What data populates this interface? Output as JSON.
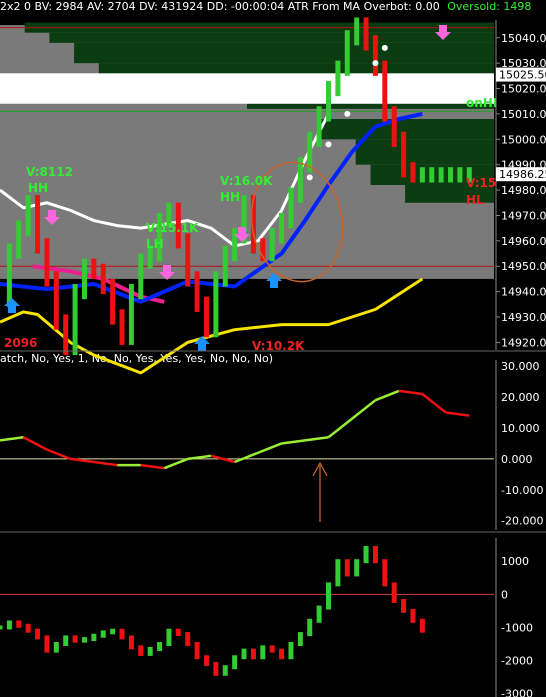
{
  "header": {
    "status_text": "2x2 0 BV: 2984 AV: 2704 DV: 431924 DD: -00:00:04 ATR From MA  Overbot: 0.00",
    "oversold_text": "Oversold: 1498"
  },
  "indicator_params": "atch, No, Yes, 1, No, No, Yes, Yes, Yes, No, No, No)",
  "colors": {
    "background": "#000000",
    "volume_profile": "#0c3d12",
    "value_area": "#7a7a7a",
    "up_bar": "#33cc33",
    "down_bar": "#ee1111",
    "blue_ma": "#0022ff",
    "white_ma": "#ffffff",
    "yellow_ma": "#f5e400",
    "magenta_ma": "#ee1e8c",
    "annotation_green": "#33ee33",
    "annotation_red": "#ee2222",
    "arrow_pink": "#ff66dd",
    "arrow_blue": "#1e90ff",
    "hand_drawn": "#c8642a"
  },
  "chart_data": [
    {
      "type": "candlestick",
      "title": "",
      "y_axis_labels": [
        "15040.00",
        "15030.00",
        "15020.00",
        "15010.00",
        "15000.00",
        "14990.00",
        "14980.00",
        "14970.00",
        "14960.00",
        "14950.00",
        "14940.00",
        "14930.00",
        "14920.00"
      ],
      "ylim": [
        14917,
        15047
      ],
      "price_tag": "15025.50",
      "last_price_tag": "14986.25",
      "series": [
        {
          "name": "price",
          "x": [
            0,
            2,
            4,
            6,
            8,
            10,
            12,
            14,
            16,
            18,
            20,
            22,
            24,
            26,
            28,
            30,
            32,
            34,
            36,
            38,
            40,
            42,
            44,
            46,
            48,
            50,
            52,
            54,
            56,
            58,
            60,
            62,
            64,
            66,
            68,
            70,
            72,
            74,
            76,
            78,
            80,
            82,
            84,
            86,
            88,
            90,
            92,
            94,
            96,
            98,
            100
          ],
          "values": [
            14937,
            14956,
            14965,
            14975,
            14958,
            14945,
            14928,
            14918,
            14940,
            14950,
            14948,
            14942,
            14930,
            14922,
            14940,
            14952,
            14955,
            14968,
            14972,
            14960,
            14945,
            14935,
            14925,
            14945,
            14955,
            14962,
            14975,
            14958,
            14955,
            14962,
            14968,
            14978,
            14990,
            15000,
            15010,
            15020,
            15028,
            15040,
            15045,
            15038,
            15028,
            15010,
            15000,
            14988,
            14986,
            14986,
            14986,
            14986,
            14986,
            14986,
            14986
          ]
        },
        {
          "name": "blue_ma",
          "x": [
            0,
            10,
            20,
            30,
            40,
            50,
            60,
            65,
            70,
            75,
            80,
            85,
            90
          ],
          "values": [
            14943,
            14941,
            14943,
            14936,
            14944,
            14942,
            14955,
            14968,
            14982,
            14995,
            15005,
            15008,
            15010
          ]
        },
        {
          "name": "white_ma",
          "x": [
            0,
            5,
            10,
            15,
            20,
            25,
            30,
            40,
            45,
            50,
            55,
            60,
            65,
            70
          ],
          "values": [
            14980,
            14973,
            14975,
            14972,
            14968,
            14966,
            14965,
            14968,
            14965,
            14958,
            14960,
            14972,
            14992,
            15010
          ]
        },
        {
          "name": "yellow_ma",
          "x": [
            0,
            5,
            8,
            15,
            20,
            30,
            40,
            50,
            60,
            70,
            80,
            90
          ],
          "values": [
            14928,
            14932,
            14931,
            14920,
            14915,
            14908,
            14920,
            14925,
            14927,
            14927,
            14933,
            14945
          ]
        },
        {
          "name": "magenta_ma",
          "x": [
            7,
            15,
            22,
            30,
            35
          ],
          "values": [
            14950,
            14948,
            14945,
            14938,
            14936
          ]
        }
      ],
      "annotations": [
        {
          "text": "V:8112",
          "color": "green"
        },
        {
          "text": "HH",
          "color": "green"
        },
        {
          "text": "V:15.1K",
          "color": "green"
        },
        {
          "text": "LH",
          "color": "green"
        },
        {
          "text": "V:16.0K",
          "color": "green"
        },
        {
          "text": "HH",
          "color": "green"
        },
        {
          "text": "V:10.2K",
          "color": "red"
        },
        {
          "text": "V:15",
          "color": "red"
        },
        {
          "text": "HL",
          "color": "red"
        },
        {
          "text": "onHI",
          "color": "green"
        },
        {
          "text": "2096",
          "color": "red"
        }
      ]
    },
    {
      "type": "line",
      "y_axis_labels": [
        "30.000",
        "20.000",
        "10.000",
        "0.000",
        "-10.000",
        "-20.000"
      ],
      "ylim": [
        -23,
        32
      ],
      "x": [
        0,
        5,
        10,
        15,
        20,
        25,
        30,
        35,
        40,
        45,
        50,
        55,
        60,
        65,
        70,
        75,
        80,
        85,
        90,
        95,
        100
      ],
      "values": [
        6,
        7,
        3,
        0,
        -1,
        -2,
        -2,
        -3,
        0,
        1,
        -1,
        2,
        5,
        6,
        7,
        13,
        19,
        22,
        21,
        15,
        14
      ]
    },
    {
      "type": "bar",
      "y_axis_labels": [
        "1000",
        "0",
        "-1000",
        "-2000",
        "-3000"
      ],
      "ylim": [
        -3100,
        1700
      ],
      "x": [
        0,
        2,
        4,
        6,
        8,
        10,
        12,
        14,
        16,
        18,
        20,
        22,
        24,
        26,
        28,
        30,
        32,
        34,
        36,
        38,
        40,
        42,
        44,
        46,
        48,
        50,
        52,
        54,
        56,
        58,
        60,
        62,
        64,
        66,
        68,
        70,
        72,
        74,
        76,
        78,
        80,
        82,
        84,
        86,
        88,
        90
      ],
      "values": [
        -1000,
        -850,
        -950,
        -1100,
        -1300,
        -1700,
        -1500,
        -1300,
        -1400,
        -1350,
        -1250,
        -1150,
        -1100,
        -1300,
        -1600,
        -1800,
        -1650,
        -1500,
        -1100,
        -1200,
        -1500,
        -1900,
        -2100,
        -2400,
        -2200,
        -1900,
        -1700,
        -1900,
        -1600,
        -1700,
        -1900,
        -1500,
        -1200,
        -800,
        -400,
        300,
        1000,
        600,
        1000,
        1400,
        1000,
        300,
        -200,
        -500,
        -800,
        -1100
      ]
    }
  ]
}
